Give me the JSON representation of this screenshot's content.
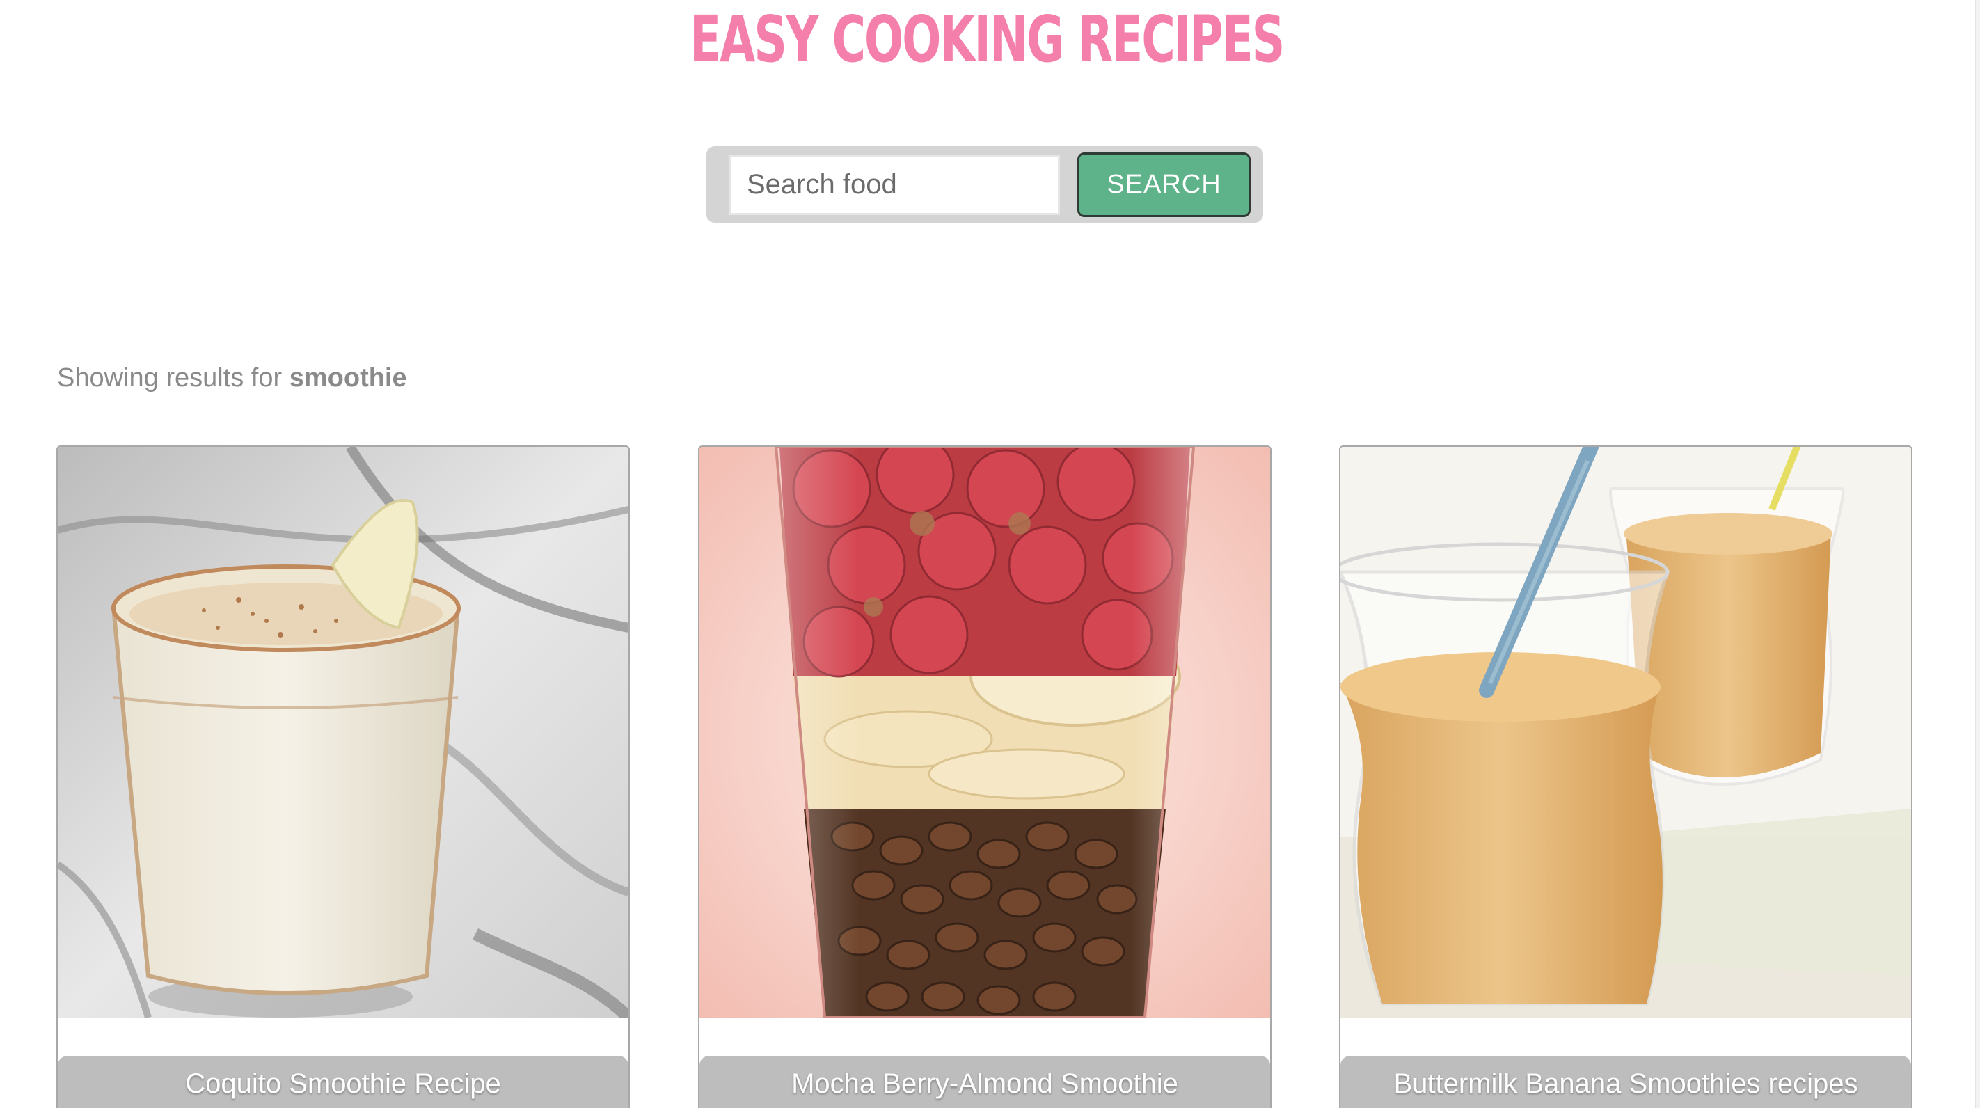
{
  "header": {
    "title": "EASY COOKING RECIPES",
    "title_color": "#f47fab"
  },
  "search": {
    "placeholder": "Search food",
    "value": "",
    "button_label": "SEARCH",
    "button_color": "#5fb38a"
  },
  "results": {
    "prefix": "Showing results for ",
    "query": "smoothie"
  },
  "recipes": [
    {
      "title": "Coquito Smoothie Recipe",
      "image_icon": "coquito-smoothie-image"
    },
    {
      "title": "Mocha Berry-Almond Smoothie",
      "image_icon": "mocha-berry-smoothie-image"
    },
    {
      "title": "Buttermilk Banana Smoothies recipes",
      "image_icon": "buttermilk-banana-smoothie-image"
    }
  ]
}
